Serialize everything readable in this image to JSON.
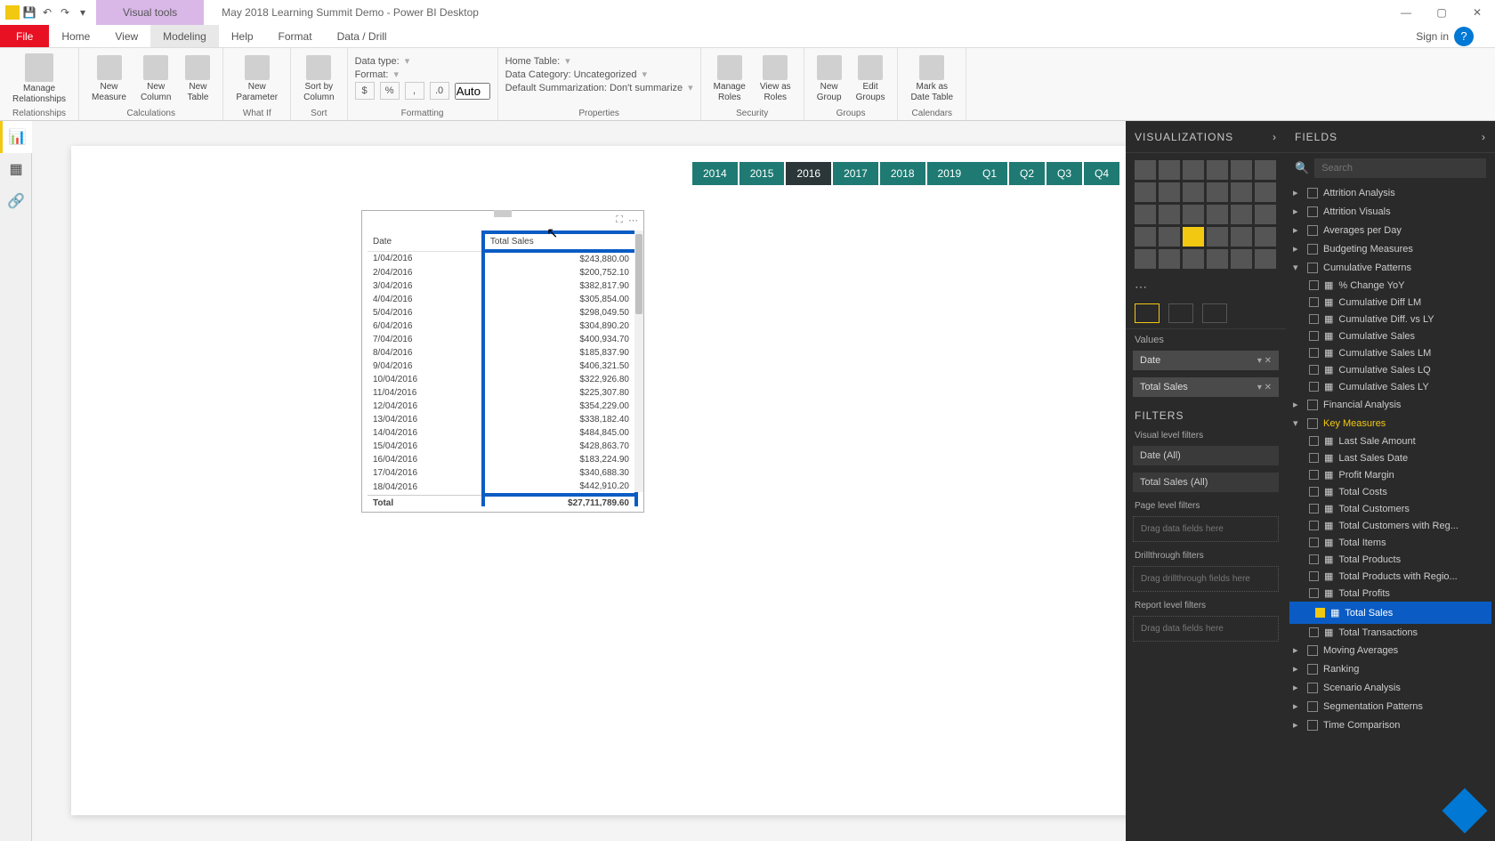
{
  "titlebar": {
    "context": "Visual tools",
    "doc": "May 2018 Learning Summit Demo - Power BI Desktop",
    "signin": "Sign in"
  },
  "tabs": {
    "file": "File",
    "home": "Home",
    "view": "View",
    "modeling": "Modeling",
    "help": "Help",
    "format": "Format",
    "datadrill": "Data / Drill"
  },
  "ribbon": {
    "relationships": {
      "manage": "Manage\nRelationships",
      "label": "Relationships"
    },
    "calculations": {
      "newmeasure": "New\nMeasure",
      "newcolumn": "New\nColumn",
      "newtable": "New\nTable",
      "label": "Calculations"
    },
    "whatif": {
      "newparam": "New\nParameter",
      "label": "What If"
    },
    "sort": {
      "sortby": "Sort by\nColumn",
      "label": "Sort"
    },
    "formatting": {
      "datatype": "Data type:",
      "format": "Format:",
      "auto": "Auto",
      "label": "Formatting"
    },
    "properties": {
      "hometable": "Home Table:",
      "datacategory": "Data Category: Uncategorized",
      "defaultsum": "Default Summarization: Don't summarize",
      "label": "Properties"
    },
    "security": {
      "manageroles": "Manage\nRoles",
      "viewas": "View as\nRoles",
      "label": "Security"
    },
    "groups": {
      "newgroup": "New\nGroup",
      "editgroups": "Edit\nGroups",
      "label": "Groups"
    },
    "calendars": {
      "markdate": "Mark as\nDate Table",
      "label": "Calendars"
    }
  },
  "slicers": {
    "years": [
      "2014",
      "2015",
      "2016",
      "2017",
      "2018",
      "2019"
    ],
    "year_selected": "2016",
    "quarters": [
      "Q1",
      "Q2",
      "Q3",
      "Q4"
    ]
  },
  "table": {
    "headers": {
      "date": "Date",
      "totalsales": "Total Sales"
    },
    "rows": [
      {
        "d": "1/04/2016",
        "v": "$243,880.00"
      },
      {
        "d": "2/04/2016",
        "v": "$200,752.10"
      },
      {
        "d": "3/04/2016",
        "v": "$382,817.90"
      },
      {
        "d": "4/04/2016",
        "v": "$305,854.00"
      },
      {
        "d": "5/04/2016",
        "v": "$298,049.50"
      },
      {
        "d": "6/04/2016",
        "v": "$304,890.20"
      },
      {
        "d": "7/04/2016",
        "v": "$400,934.70"
      },
      {
        "d": "8/04/2016",
        "v": "$185,837.90"
      },
      {
        "d": "9/04/2016",
        "v": "$406,321.50"
      },
      {
        "d": "10/04/2016",
        "v": "$322,926.80"
      },
      {
        "d": "11/04/2016",
        "v": "$225,307.80"
      },
      {
        "d": "12/04/2016",
        "v": "$354,229.00"
      },
      {
        "d": "13/04/2016",
        "v": "$338,182.40"
      },
      {
        "d": "14/04/2016",
        "v": "$484,845.00"
      },
      {
        "d": "15/04/2016",
        "v": "$428,863.70"
      },
      {
        "d": "16/04/2016",
        "v": "$183,224.90"
      },
      {
        "d": "17/04/2016",
        "v": "$340,688.30"
      },
      {
        "d": "18/04/2016",
        "v": "$442,910.20"
      }
    ],
    "total": {
      "label": "Total",
      "value": "$27,711,789.60"
    }
  },
  "vizpane": {
    "header": "VISUALIZATIONS",
    "values": "Values",
    "well": {
      "date": "Date",
      "totalsales": "Total Sales"
    },
    "filters": "FILTERS",
    "visuallevel": "Visual level filters",
    "date_all": "Date (All)",
    "ts_all": "Total Sales (All)",
    "pagelevel": "Page level filters",
    "drag": "Drag data fields here",
    "drill": "Drillthrough filters",
    "dragdrill": "Drag drillthrough fields here",
    "reportlevel": "Report level filters"
  },
  "fieldspane": {
    "header": "FIELDS",
    "search": "Search",
    "tables": [
      {
        "name": "Attrition Analysis",
        "expanded": false
      },
      {
        "name": "Attrition Visuals",
        "expanded": false
      },
      {
        "name": "Averages per Day",
        "expanded": false
      },
      {
        "name": "Budgeting Measures",
        "expanded": false
      },
      {
        "name": "Cumulative Patterns",
        "expanded": true,
        "fields": [
          "% Change YoY",
          "Cumulative Diff LM",
          "Cumulative Diff. vs LY",
          "Cumulative Sales",
          "Cumulative Sales LM",
          "Cumulative Sales LQ",
          "Cumulative Sales LY"
        ]
      },
      {
        "name": "Financial Analysis",
        "expanded": false
      },
      {
        "name": "Key Measures",
        "expanded": true,
        "active": true,
        "fields": [
          "Last Sale Amount",
          "Last Sales Date",
          "Profit Margin",
          "Total Costs",
          "Total Customers",
          "Total Customers with Reg...",
          "Total Items",
          "Total Products",
          "Total Products with Regio...",
          "Total Profits",
          "Total Sales",
          "Total Transactions"
        ]
      },
      {
        "name": "Moving Averages",
        "expanded": false
      },
      {
        "name": "Ranking",
        "expanded": false
      },
      {
        "name": "Scenario Analysis",
        "expanded": false
      },
      {
        "name": "Segmentation Patterns",
        "expanded": false
      },
      {
        "name": "Time Comparison",
        "expanded": false
      }
    ],
    "checked_field": "Total Sales",
    "highlighted_field": "Total Sales"
  }
}
